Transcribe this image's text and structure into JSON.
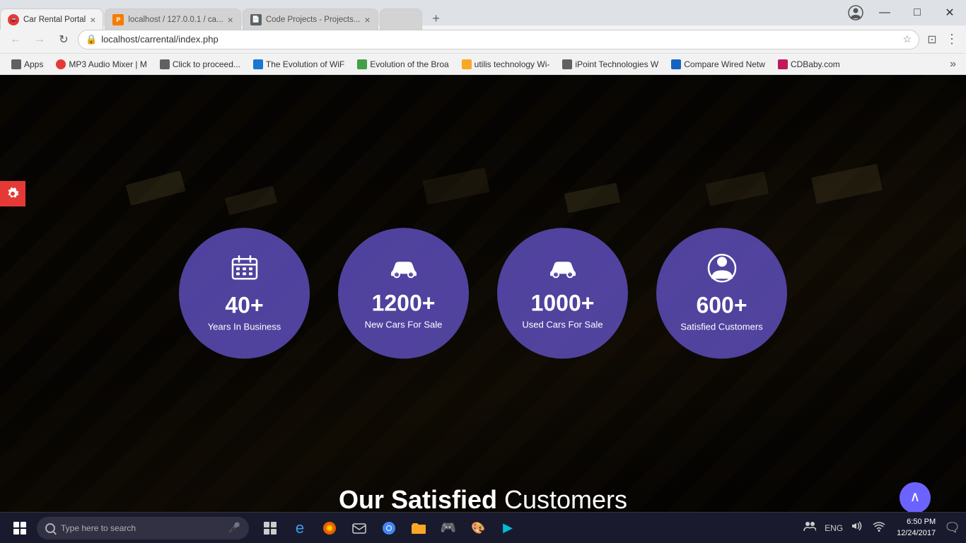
{
  "browser": {
    "tabs": [
      {
        "id": "tab1",
        "favicon_color": "fav-red",
        "favicon_text": "🚗",
        "title": "Car Rental Portal",
        "active": true
      },
      {
        "id": "tab2",
        "favicon_color": "fav-orange",
        "favicon_text": "P",
        "title": "localhost / 127.0.0.1 / ca...",
        "active": false
      },
      {
        "id": "tab3",
        "favicon_color": "fav-gray",
        "favicon_text": "📄",
        "title": "Code Projects - Projects...",
        "active": false
      }
    ],
    "url": "localhost/carrental/index.php",
    "url_display": "localhost/carrental/index.php"
  },
  "bookmarks": [
    {
      "label": "Apps",
      "favicon_color": "fav-gray",
      "show_icon": true
    },
    {
      "label": "MP3 Audio Mixer | M",
      "favicon_color": "fav-red",
      "show_icon": true
    },
    {
      "label": "Click to proceed...",
      "favicon_color": "fav-gray",
      "show_icon": true
    },
    {
      "label": "The Evolution of WiF",
      "favicon_color": "fav-blue",
      "show_icon": true
    },
    {
      "label": "Evolution of the Broa",
      "favicon_color": "fav-green",
      "show_icon": true
    },
    {
      "label": "utilis technology Wi-",
      "favicon_color": "fav-yellow",
      "show_icon": true
    },
    {
      "label": "iPoint Technologies W",
      "favicon_color": "fav-gray",
      "show_icon": true
    },
    {
      "label": "Compare Wired Netw",
      "favicon_color": "fav-darkblue",
      "show_icon": true
    },
    {
      "label": "CDBaby.com",
      "favicon_color": "fav-pink",
      "show_icon": true
    }
  ],
  "stats": [
    {
      "icon": "📅",
      "number": "40+",
      "label": "Years In Business"
    },
    {
      "icon": "🚗",
      "number": "1200+",
      "label": "New Cars For Sale"
    },
    {
      "icon": "🚘",
      "number": "1000+",
      "label": "Used Cars For Sale"
    },
    {
      "icon": "👤",
      "number": "600+",
      "label": "Satisfied Customers"
    }
  ],
  "satisfied_heading": {
    "bold_part": "Our Satisfied",
    "normal_part": " Customers"
  },
  "taskbar": {
    "search_placeholder": "Type here to search",
    "icons": [
      "⊞",
      "🔲",
      "e",
      "🦊",
      "✉",
      "🌐",
      "📁",
      "🎮",
      "🎨",
      "▶"
    ],
    "time": "6:50 PM",
    "date": "12/24/2017"
  },
  "scroll_top_icon": "^"
}
